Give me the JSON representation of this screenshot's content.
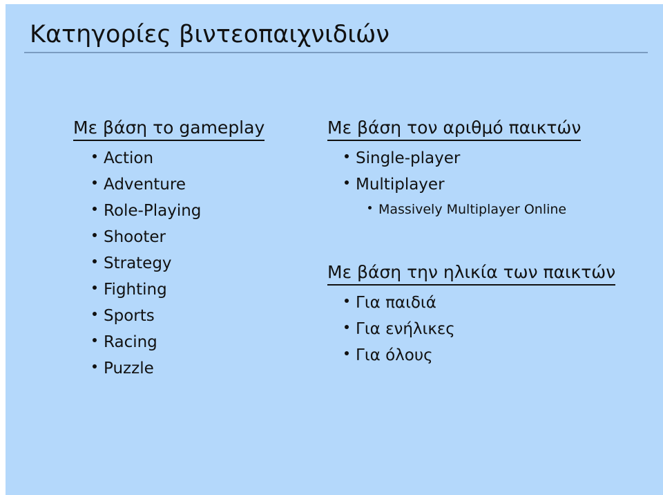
{
  "slide": {
    "title": "Κατηγορίες βιντεοπαιχνιδιών",
    "background_color": "#b4d8fb",
    "text_color": "#111111",
    "rule_color": "#7a9cc0"
  },
  "left_column": {
    "sections": [
      {
        "heading": "Με βάση το gameplay",
        "items": [
          "Action",
          "Adventure",
          "Role-Playing",
          "Shooter",
          "Strategy",
          "Fighting",
          "Sports",
          "Racing",
          "Puzzle"
        ]
      }
    ]
  },
  "right_column": {
    "sections": [
      {
        "heading": "Με βάση τον αριθμό παικτών",
        "items": [
          "Single-player",
          "Multiplayer"
        ],
        "subitems": [
          "Massively Multiplayer Online"
        ]
      },
      {
        "heading": "Με βάση την ηλικία των παικτών",
        "items": [
          "Για παιδιά",
          "Για ενήλικες",
          "Για όλους"
        ]
      }
    ]
  }
}
